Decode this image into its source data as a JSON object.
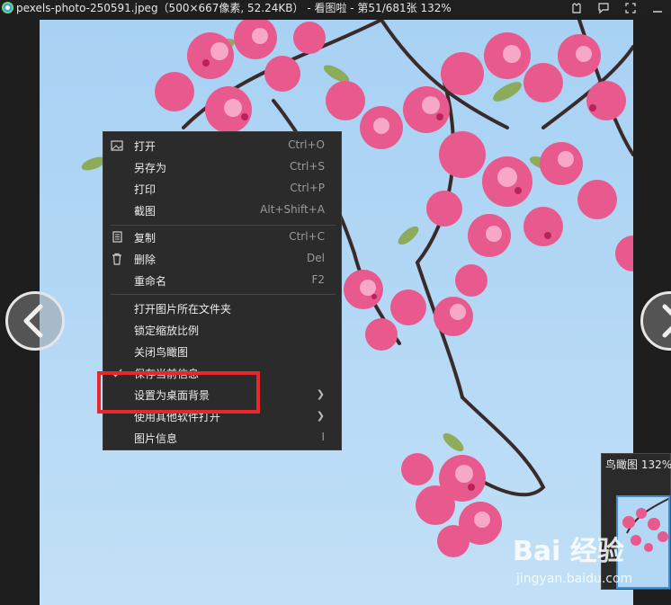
{
  "window": {
    "title": "pexels-photo-250591.jpeg（500×667像素, 52.24KB） - 看图啦 - 第51/681张 132%"
  },
  "context_menu": {
    "items": [
      {
        "label": "打开",
        "shortcut": "Ctrl+O",
        "icon": "image-icon"
      },
      {
        "label": "另存为",
        "shortcut": "Ctrl+S"
      },
      {
        "label": "打印",
        "shortcut": "Ctrl+P"
      },
      {
        "label": "截图",
        "shortcut": "Alt+Shift+A"
      },
      {
        "label": "复制",
        "shortcut": "Ctrl+C",
        "icon": "copy-icon"
      },
      {
        "label": "删除",
        "shortcut": "Del",
        "icon": "trash-icon"
      },
      {
        "label": "重命名",
        "shortcut": "F2"
      },
      {
        "label": "打开图片所在文件夹"
      },
      {
        "label": "锁定缩放比例"
      },
      {
        "label": "关闭鸟瞰图"
      },
      {
        "label": "保存当前信息",
        "checked": true
      },
      {
        "label": "设置为桌面背景",
        "submenu": true
      },
      {
        "label": "使用其他软件打开",
        "submenu": true
      },
      {
        "label": "图片信息",
        "shortcut": "I"
      }
    ]
  },
  "birdseye": {
    "title": "鸟瞰图",
    "zoom": "132%"
  },
  "watermark": {
    "logo": "Bai 经验",
    "url": "jingyan.baidu.com"
  },
  "colors": {
    "highlight": "#e8262b",
    "sky": "#b3d8f5",
    "blossom": "#e85a8e"
  }
}
